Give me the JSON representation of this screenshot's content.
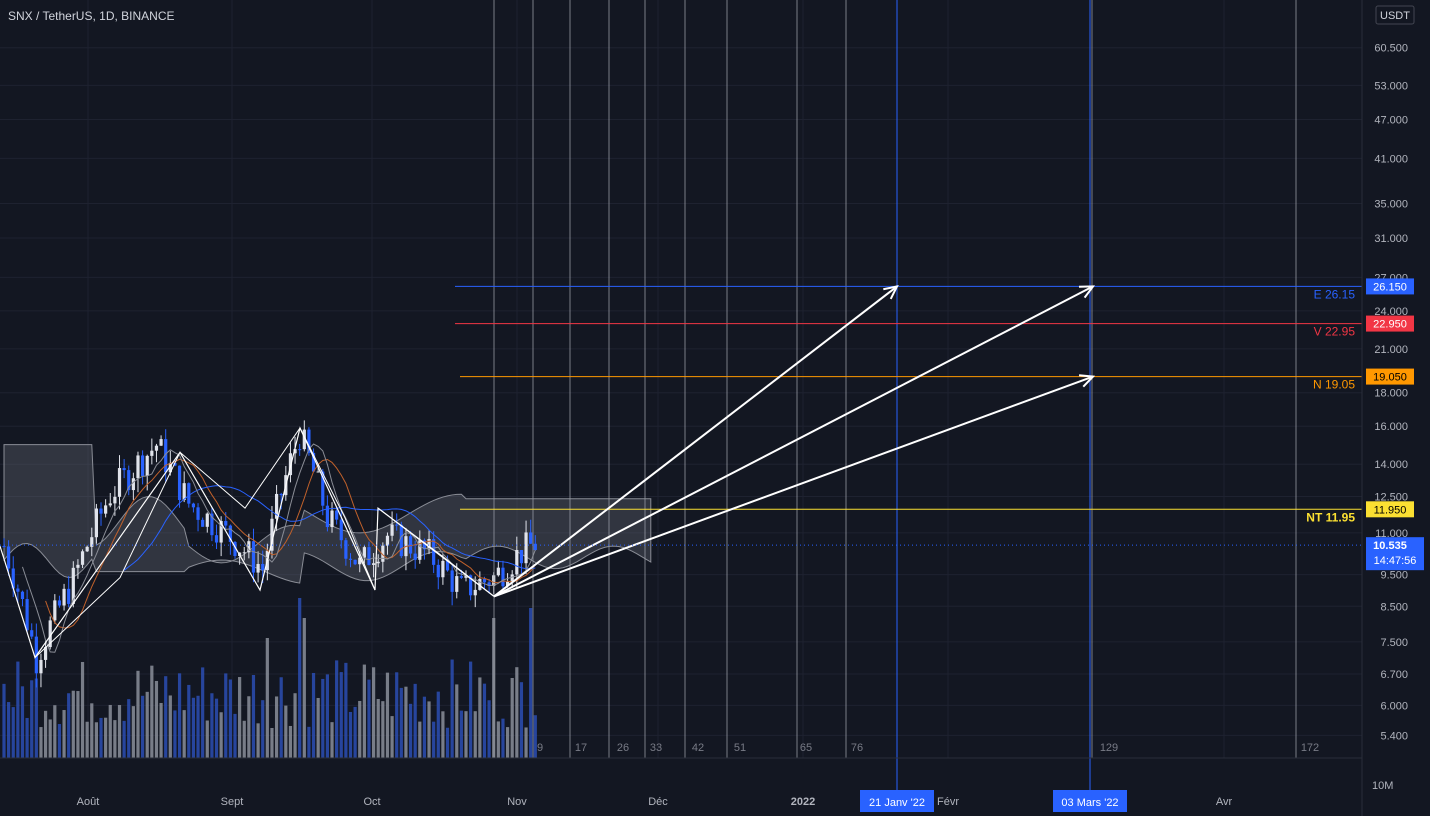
{
  "header": {
    "symbol_title": "SNX / TetherUS, 1D, BINANCE",
    "currency": "USDT"
  },
  "colors": {
    "background": "#131722",
    "grid": "#1e2230",
    "axis_text": "#b2b5be",
    "bull": "#e0e3eb",
    "bear": "#2962ff",
    "cloud": "#6b6e78",
    "blue_marker": "#2962ff",
    "target_e": "#2962ff",
    "target_v": "#f23645",
    "target_n": "#ff9800",
    "target_nt": "#fbe032"
  },
  "price_axis": {
    "ticks": [
      "60.500",
      "53.000",
      "47.000",
      "41.000",
      "35.000",
      "31.000",
      "27.000",
      "24.000",
      "21.000",
      "18.000",
      "16.000",
      "14.000",
      "12.500",
      "11.000",
      "9.500",
      "8.500",
      "7.500",
      "6.700",
      "6.000",
      "5.400"
    ],
    "volume_label": "10M",
    "current_price": "10.535",
    "countdown": "14:47:56"
  },
  "time_axis": {
    "labels": [
      "Août",
      "Sept",
      "Oct",
      "Nov",
      "Déc",
      "2022",
      "Févr",
      "Avr"
    ],
    "highlight_labels": [
      "21 Janv '22",
      "03 Mars '22"
    ]
  },
  "fib_time_numbers": [
    "9",
    "17",
    "26",
    "33",
    "42",
    "51",
    "65",
    "76",
    "129",
    "172"
  ],
  "targets": [
    {
      "code": "E",
      "value": 26.15,
      "label": "E 26.15",
      "tag": "26.150",
      "color": "#2962ff",
      "tag_text": "#ffffff"
    },
    {
      "code": "V",
      "value": 22.95,
      "label": "V 22.95",
      "tag": "22.950",
      "color": "#f23645",
      "tag_text": "#ffffff"
    },
    {
      "code": "N",
      "value": 19.05,
      "label": "N 19.05",
      "tag": "19.050",
      "color": "#ff9800",
      "tag_text": "#000000"
    },
    {
      "code": "NT",
      "value": 11.95,
      "label": "NT 11.95",
      "tag": "11.950",
      "color": "#fbe032",
      "tag_text": "#000000"
    }
  ],
  "chart_data": {
    "type": "candlestick",
    "symbol": "SNX/USDT",
    "interval": "1D",
    "exchange": "BINANCE",
    "scale": "log",
    "ylim": [
      5.2,
      63
    ],
    "x_labels": [
      "Août",
      "Sept",
      "Oct",
      "Nov",
      "Déc",
      "2022",
      "Févr",
      "Avr"
    ],
    "current_price": 10.535,
    "targets": {
      "E": 26.15,
      "V": 22.95,
      "N": 19.05,
      "NT": 11.95
    },
    "zigzag_pattern": [
      10.5,
      7.1,
      14.6,
      9.0,
      15.9,
      9.0,
      12.0,
      8.8
    ],
    "projections": [
      {
        "from": 8.8,
        "to": 26.15,
        "target_date": "21 Janv '22"
      },
      {
        "from": 8.8,
        "to": 26.15,
        "target_date": "03 Mars '22"
      },
      {
        "from": 8.8,
        "to": 19.05,
        "target_date": "03 Mars '22"
      }
    ],
    "fibonacci_time_zones": [
      9,
      17,
      26,
      33,
      42,
      51,
      65,
      76,
      129,
      172
    ]
  }
}
